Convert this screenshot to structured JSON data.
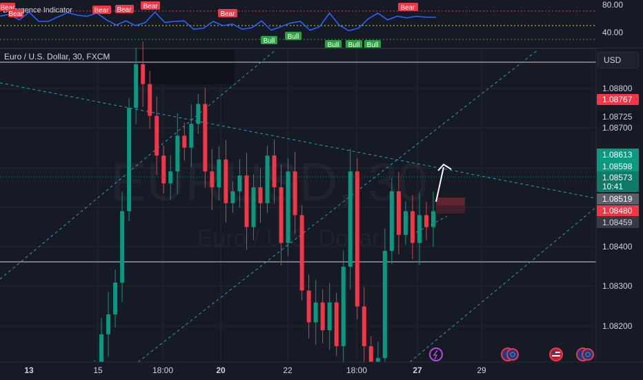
{
  "indicator": {
    "name": "Divergence Indicator",
    "scale": [
      "80.00",
      "40.00"
    ],
    "bear_labels": [
      "Bear",
      "Bear",
      "Bear",
      "Bear",
      "Bear",
      "Bear",
      "Bear"
    ],
    "bull_labels": [
      "Bull",
      "Bull",
      "Bull",
      "Bull",
      "Bull"
    ],
    "bull_color": "#2ea043",
    "bear_color": "#f23645",
    "line_color": "#2962ff"
  },
  "symbol": {
    "legend": "Euro / U.S. Dollar, 30, FXCM",
    "watermark_ticker": "EURUSD, 30",
    "watermark_name": "Euro / U.S. Dollar"
  },
  "currency_button": "USD",
  "price_axis": {
    "ticks": [
      "1.08800",
      "1.08700",
      "1.08400",
      "1.08300",
      "1.08200"
    ],
    "labels": {
      "upper_red": "1.08767",
      "dark_upper": "1.08725",
      "green_top": "1.08613",
      "green_bottom": "1.08598",
      "current_price": "1.08573",
      "countdown": "10:41",
      "grey": "1.08519",
      "red_lower": "1.08480",
      "dark_lower": "1.08459"
    }
  },
  "time_axis": [
    "13",
    "15",
    "18:00",
    "20",
    "22",
    "18:00",
    "27",
    "29"
  ],
  "colors": {
    "background": "#161a25",
    "bull_candle": "#089981",
    "bear_candle": "#f23645",
    "trendline": "#22a3c2",
    "accent_green": "#089981",
    "accent_red": "#f23645"
  },
  "chart_data": {
    "type": "candlestick",
    "title": "Euro / U.S. Dollar, 30, FXCM",
    "x": [
      "13",
      "15",
      "18:00",
      "20",
      "22",
      "18:00",
      "27",
      "29"
    ],
    "ylim": [
      1.0814,
      1.0893
    ],
    "closes": [
      1.0812,
      1.0821,
      1.0826,
      1.0834,
      1.0852,
      1.0878,
      1.0889,
      1.0884,
      1.0876,
      1.0866,
      1.0859,
      1.0862,
      1.0871,
      1.0868,
      1.0874,
      1.0879,
      1.0862,
      1.0858,
      1.0865,
      1.0854,
      1.0857,
      1.0861,
      1.0848,
      1.0858,
      1.0854,
      1.0866,
      1.0858,
      1.0844,
      1.0862,
      1.0851,
      1.0832,
      1.0824,
      1.0829,
      1.0822,
      1.0829,
      1.0818,
      1.0838,
      1.0862,
      1.0828,
      1.0818,
      1.0812,
      1.0815,
      1.0842,
      1.0857,
      1.0846,
      1.0852,
      1.0844,
      1.0851,
      1.0848,
      1.0852
    ],
    "horizontal_levels": [
      1.0889,
      1.08355
    ],
    "projection": [
      1.0848,
      1.0861
    ],
    "rsi": [
      70,
      74,
      63,
      78,
      60,
      60,
      69,
      77,
      72,
      70,
      76,
      63,
      53,
      61,
      52,
      58,
      78,
      58,
      60,
      61,
      45,
      47,
      60,
      52,
      55,
      45,
      48,
      61,
      43,
      50,
      57,
      60,
      43,
      50,
      76,
      53,
      42,
      47,
      65,
      76,
      63,
      70,
      67,
      70,
      68,
      68
    ]
  }
}
